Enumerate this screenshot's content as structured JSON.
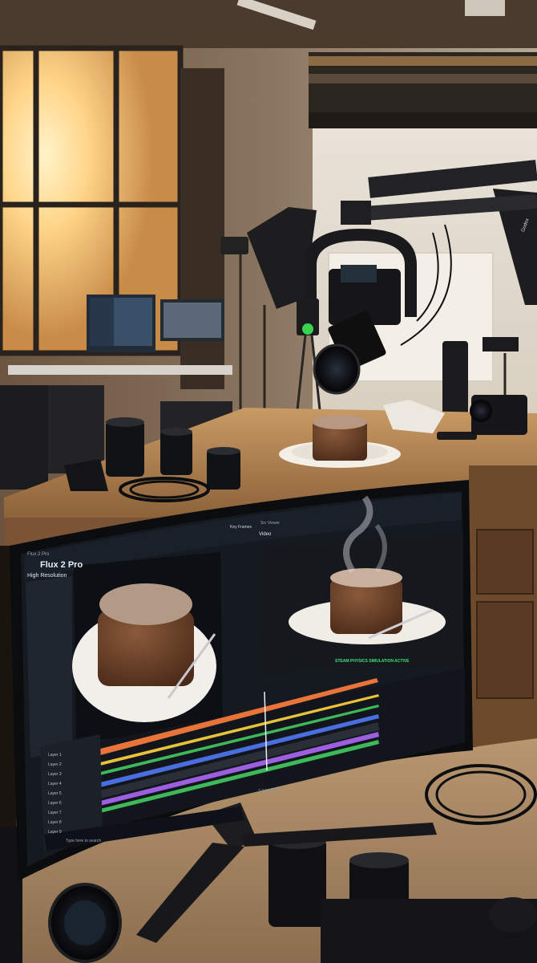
{
  "app": {
    "window_title": "Flux 2 Pro",
    "name": "Flux 2 Pro",
    "preset": "High Resolution",
    "tabs": [
      "Key Frames",
      "Src Viewer"
    ],
    "viewer_label": "Video",
    "status_banner": "STEAM PHYSICS SIMULATION ACTIVE",
    "layers": [
      "Layer 1",
      "Layer 2",
      "Layer 3",
      "Layer 4",
      "Layer 5",
      "Layer 6",
      "Layer 7",
      "Layer 8",
      "Layer 9"
    ],
    "search_placeholder": "Type here to search"
  },
  "monitor": {
    "brand": "SAMSUNG"
  },
  "softbox_label": "Godox",
  "colors": {
    "window_light": "#ffd58a",
    "ui_dark": "#1c222b",
    "track_orange": "#e8743a",
    "track_yellow": "#e8c23a",
    "track_blue": "#4a6ee0",
    "track_purple": "#9b5fe0",
    "track_green": "#3fb85a",
    "status_green": "#3fe27a"
  }
}
